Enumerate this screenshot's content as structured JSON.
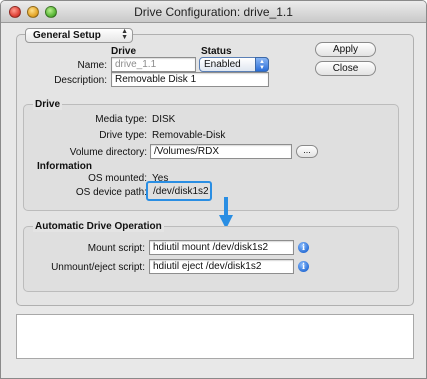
{
  "window": {
    "title": "Drive Configuration: drive_1.1"
  },
  "section_popup": {
    "value": "General Setup"
  },
  "drive_header": "Drive",
  "status_header": "Status",
  "name": {
    "label": "Name:",
    "placeholder": "drive_1.1"
  },
  "status_select": {
    "value": "Enabled"
  },
  "description": {
    "label": "Description:",
    "value": "Removable Disk 1"
  },
  "buttons": {
    "apply": "Apply",
    "close": "Close",
    "ellipsis": "..."
  },
  "drive_group": {
    "title": "Drive",
    "media_type_label": "Media type:",
    "media_type_value": "DISK",
    "drive_type_label": "Drive type:",
    "drive_type_value": "Removable-Disk",
    "volume_dir_label": "Volume directory:",
    "volume_dir_value": "/Volumes/RDX",
    "information_title": "Information",
    "os_mounted_label": "OS mounted:",
    "os_mounted_value": "Yes",
    "os_device_label": "OS device path:",
    "os_device_value": "/dev/disk1s2"
  },
  "auto_group": {
    "title": "Automatic Drive Operation",
    "mount_label": "Mount script:",
    "mount_value": "hdiutil mount /dev/disk1s2",
    "unmount_label": "Unmount/eject script:",
    "unmount_value": "hdiutil eject /dev/disk1s2"
  },
  "icons": {
    "info": "i",
    "popup_arrows": "▲▼",
    "select_arrows": "▲▼"
  },
  "colors": {
    "highlight": "#2a8ee3",
    "arrow": "#2a8ee3"
  }
}
